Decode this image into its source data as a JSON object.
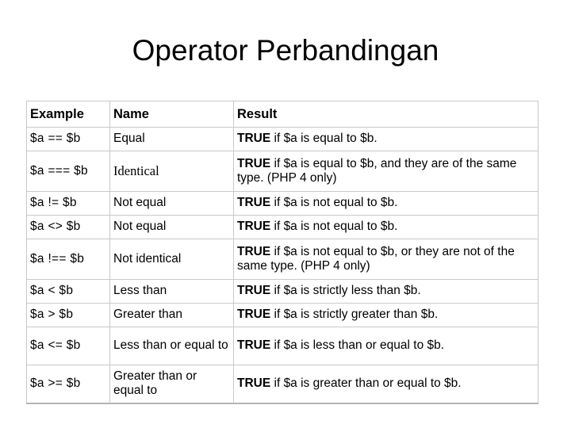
{
  "slide": {
    "title": "Operator Perbandingan"
  },
  "table": {
    "headers": {
      "example": "Example",
      "name": "Name",
      "result": "Result"
    },
    "rows": [
      {
        "example": "$a == $b",
        "name": "Equal",
        "result_bold": "TRUE",
        "result_rest": " if $a is equal to $b."
      },
      {
        "example": "$a === $b",
        "name": "Identical",
        "result_bold": "TRUE",
        "result_rest": " if $a is equal to $b, and they are of the same type. (PHP 4 only)"
      },
      {
        "example": "$a != $b",
        "name": "Not equal",
        "result_bold": "TRUE",
        "result_rest": " if $a is not equal to $b."
      },
      {
        "example": "$a <> $b",
        "name": "Not equal",
        "result_bold": "TRUE",
        "result_rest": " if $a is not equal to $b."
      },
      {
        "example": "$a !== $b",
        "name": "Not identical",
        "result_bold": "TRUE",
        "result_rest": " if $a is not equal to $b, or they are not of the same type. (PHP 4 only)"
      },
      {
        "example": "$a < $b",
        "name": "Less than",
        "result_bold": "TRUE",
        "result_rest": " if $a is strictly less than $b."
      },
      {
        "example": "$a > $b",
        "name": "Greater than",
        "result_bold": "TRUE",
        "result_rest": " if $a is strictly greater than $b."
      },
      {
        "example": "$a <= $b",
        "name": "Less than or equal to",
        "result_bold": "TRUE",
        "result_rest": " if $a is less than or equal to $b."
      },
      {
        "example": "$a >= $b",
        "name": "Greater than or equal to",
        "result_bold": "TRUE",
        "result_rest": " if $a is greater than or equal to $b."
      }
    ]
  },
  "colors": {
    "background": "#ffffff",
    "text": "#000000",
    "border": "#c9c9c9",
    "border_bottom": "#b4b4b4"
  }
}
